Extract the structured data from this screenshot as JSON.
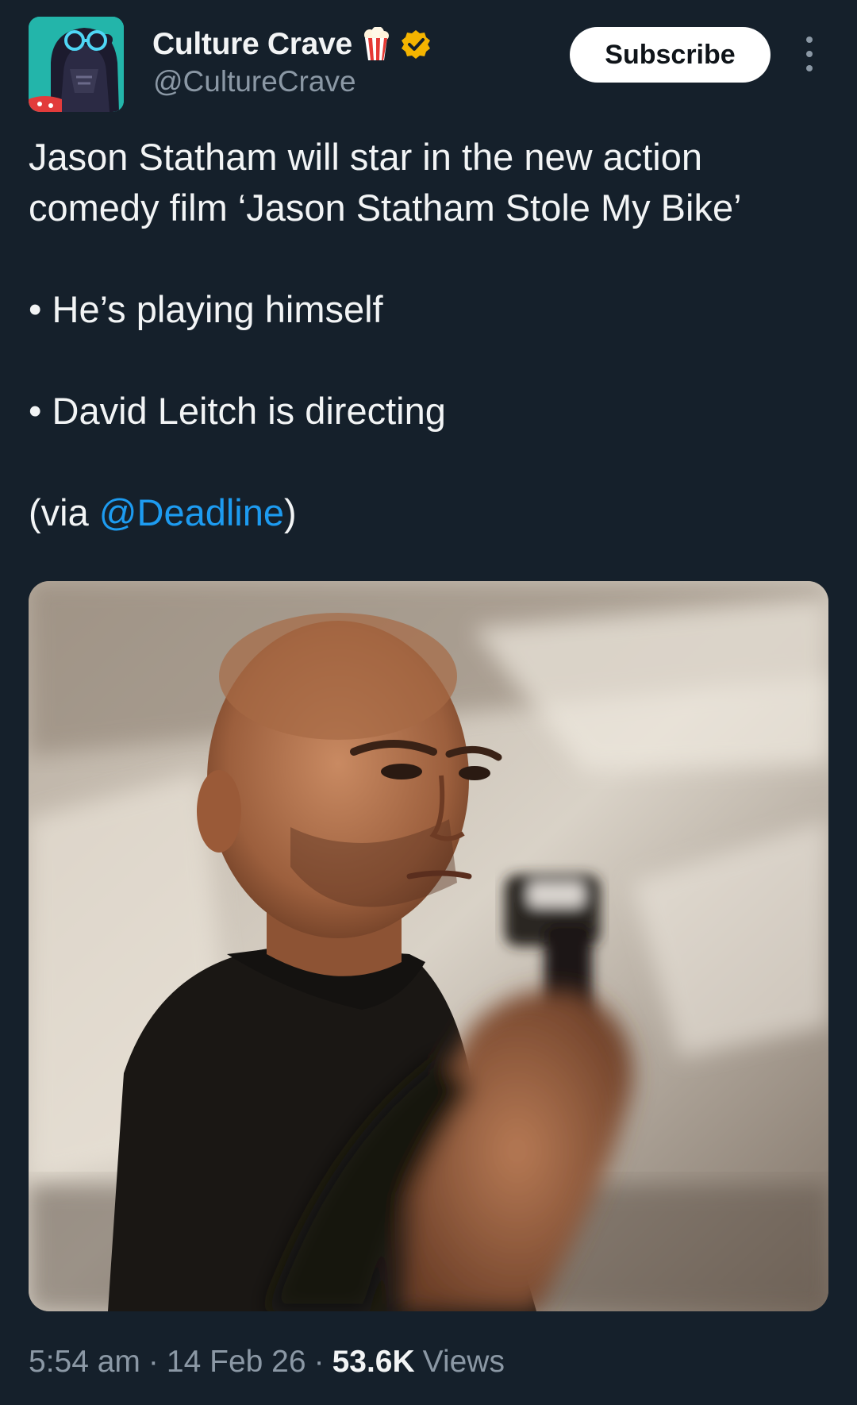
{
  "author": {
    "display_name": "Culture Crave",
    "handle": "@CultureCrave",
    "badge_icon": "popcorn-icon",
    "verified_icon": "verified-badge-icon",
    "verified_color": "#f4b400"
  },
  "actions": {
    "subscribe_label": "Subscribe",
    "more_icon": "more-vertical-icon"
  },
  "tweet": {
    "line1": "Jason Statham will star in the new action",
    "line2": "comedy film ‘Jason Statham Stole My Bike’",
    "bullet1": "• He’s playing himself",
    "bullet2": "• David Leitch is directing",
    "via_prefix": "(via ",
    "via_mention": "@Deadline",
    "via_suffix": ")",
    "link_color": "#1d9bf0"
  },
  "media": {
    "type": "photo"
  },
  "footer": {
    "time": "5:54 am",
    "date": "14 Feb 26",
    "views_count": "53.6K",
    "views_label": "Views",
    "separator": "·"
  }
}
